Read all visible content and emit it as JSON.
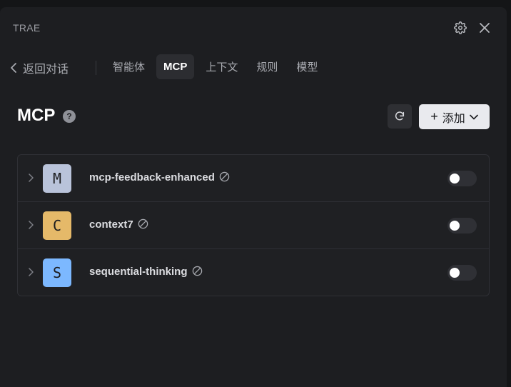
{
  "app": {
    "title": "TRAE"
  },
  "nav": {
    "back_label": "返回对话",
    "tabs": [
      {
        "label": "智能体",
        "active": false
      },
      {
        "label": "MCP",
        "active": true
      },
      {
        "label": "上下文",
        "active": false
      },
      {
        "label": "规则",
        "active": false
      },
      {
        "label": "模型",
        "active": false
      }
    ]
  },
  "section": {
    "title": "MCP",
    "help_glyph": "?",
    "add_label": "添加",
    "add_plus": "+"
  },
  "servers": [
    {
      "initial": "M",
      "name": "mcp-feedback-enhanced",
      "color": "#b9c3da",
      "enabled": false
    },
    {
      "initial": "C",
      "name": "context7",
      "color": "#e5b969",
      "enabled": false
    },
    {
      "initial": "S",
      "name": "sequential-thinking",
      "color": "#7cb8ff",
      "enabled": false
    }
  ],
  "icons": [
    "gear-icon",
    "close-icon",
    "chevron-left-icon",
    "help-icon",
    "refresh-icon",
    "chevron-down-icon",
    "chevron-right-icon",
    "disabled-icon"
  ]
}
